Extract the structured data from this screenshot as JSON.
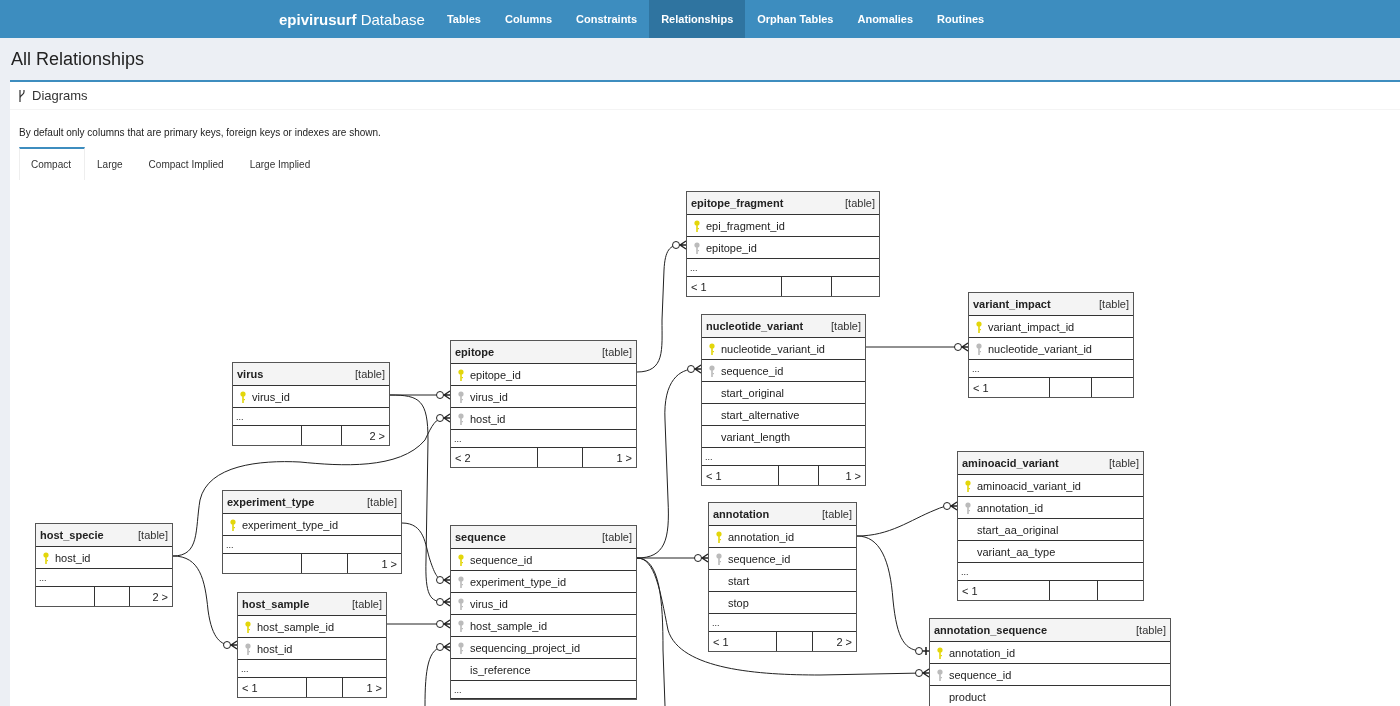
{
  "navbar": {
    "brand": "**epivirusurf** Database",
    "items": [
      {
        "label": "Tables",
        "selected": false
      },
      {
        "label": "Columns",
        "selected": false
      },
      {
        "label": "Constraints",
        "selected": false
      },
      {
        "label": "Relationships",
        "selected": true
      },
      {
        "label": "Orphan Tables",
        "selected": false
      },
      {
        "label": "Anomalies",
        "selected": false
      },
      {
        "label": "Routines",
        "selected": false
      }
    ]
  },
  "page_title": "All Relationships",
  "panel": {
    "title": "Diagrams",
    "description": "By default only columns that are primary keys, foreign keys or indexes are shown.",
    "tabs": [
      {
        "label": "Compact",
        "selected": true
      },
      {
        "label": "Large",
        "selected": false
      },
      {
        "label": "Compact Implied",
        "selected": false
      },
      {
        "label": "Large Implied",
        "selected": false
      }
    ]
  },
  "diagram": {
    "tables": [
      {
        "name": "epitope_fragment",
        "type": "[table]",
        "columns": [
          {
            "name": "epi_fragment_id",
            "kind": "primary"
          },
          {
            "name": "epitope_id",
            "kind": "foreign"
          }
        ],
        "more": "...",
        "footer": {
          "left": "< 1"
        }
      },
      {
        "name": "virus",
        "type": "[table]",
        "columns": [
          {
            "name": "virus_id",
            "kind": "primary"
          }
        ],
        "more": "...",
        "footer": {
          "right": "2 >"
        }
      },
      {
        "name": "epitope",
        "type": "[table]",
        "columns": [
          {
            "name": "epitope_id",
            "kind": "primary"
          },
          {
            "name": "virus_id",
            "kind": "foreign"
          },
          {
            "name": "host_id",
            "kind": "foreign"
          }
        ],
        "more": "...",
        "footer": {
          "left": "< 2",
          "right": "1 >"
        }
      },
      {
        "name": "nucleotide_variant",
        "type": "[table]",
        "columns": [
          {
            "name": "nucleotide_variant_id",
            "kind": "primary"
          },
          {
            "name": "sequence_id",
            "kind": "foreign"
          },
          {
            "name": "start_original",
            "kind": "plain"
          },
          {
            "name": "start_alternative",
            "kind": "plain"
          },
          {
            "name": "variant_length",
            "kind": "plain"
          }
        ],
        "more": "...",
        "footer": {
          "left": "< 1",
          "right": "1 >"
        }
      },
      {
        "name": "variant_impact",
        "type": "[table]",
        "columns": [
          {
            "name": "variant_impact_id",
            "kind": "primary"
          },
          {
            "name": "nucleotide_variant_id",
            "kind": "foreign"
          }
        ],
        "more": "...",
        "footer": {
          "left": "< 1"
        }
      },
      {
        "name": "host_specie",
        "type": "[table]",
        "columns": [
          {
            "name": "host_id",
            "kind": "primary"
          }
        ],
        "more": "...",
        "footer": {
          "right": "2 >"
        }
      },
      {
        "name": "experiment_type",
        "type": "[table]",
        "columns": [
          {
            "name": "experiment_type_id",
            "kind": "primary"
          }
        ],
        "more": "...",
        "footer": {
          "right": "1 >"
        }
      },
      {
        "name": "host_sample",
        "type": "[table]",
        "columns": [
          {
            "name": "host_sample_id",
            "kind": "primary"
          },
          {
            "name": "host_id",
            "kind": "foreign"
          }
        ],
        "more": "...",
        "footer": {
          "left": "< 1",
          "right": "1 >"
        }
      },
      {
        "name": "sequence",
        "type": "[table]",
        "columns": [
          {
            "name": "sequence_id",
            "kind": "primary"
          },
          {
            "name": "experiment_type_id",
            "kind": "foreign"
          },
          {
            "name": "virus_id",
            "kind": "foreign"
          },
          {
            "name": "host_sample_id",
            "kind": "foreign"
          },
          {
            "name": "sequencing_project_id",
            "kind": "foreign"
          },
          {
            "name": "is_reference",
            "kind": "plain"
          }
        ],
        "more": "..."
      },
      {
        "name": "annotation",
        "type": "[table]",
        "columns": [
          {
            "name": "annotation_id",
            "kind": "primary"
          },
          {
            "name": "sequence_id",
            "kind": "foreign"
          },
          {
            "name": "start",
            "kind": "plain"
          },
          {
            "name": "stop",
            "kind": "plain"
          }
        ],
        "more": "...",
        "footer": {
          "left": "< 1",
          "right": "2 >"
        }
      },
      {
        "name": "aminoacid_variant",
        "type": "[table]",
        "columns": [
          {
            "name": "aminoacid_variant_id",
            "kind": "primary"
          },
          {
            "name": "annotation_id",
            "kind": "foreign"
          },
          {
            "name": "start_aa_original",
            "kind": "plain"
          },
          {
            "name": "variant_aa_type",
            "kind": "plain"
          }
        ],
        "more": "...",
        "footer": {
          "left": "< 1"
        }
      },
      {
        "name": "annotation_sequence",
        "type": "[table]",
        "columns": [
          {
            "name": "annotation_id",
            "kind": "primary"
          },
          {
            "name": "sequence_id",
            "kind": "foreign"
          },
          {
            "name": "product",
            "kind": "plain"
          }
        ]
      }
    ]
  }
}
